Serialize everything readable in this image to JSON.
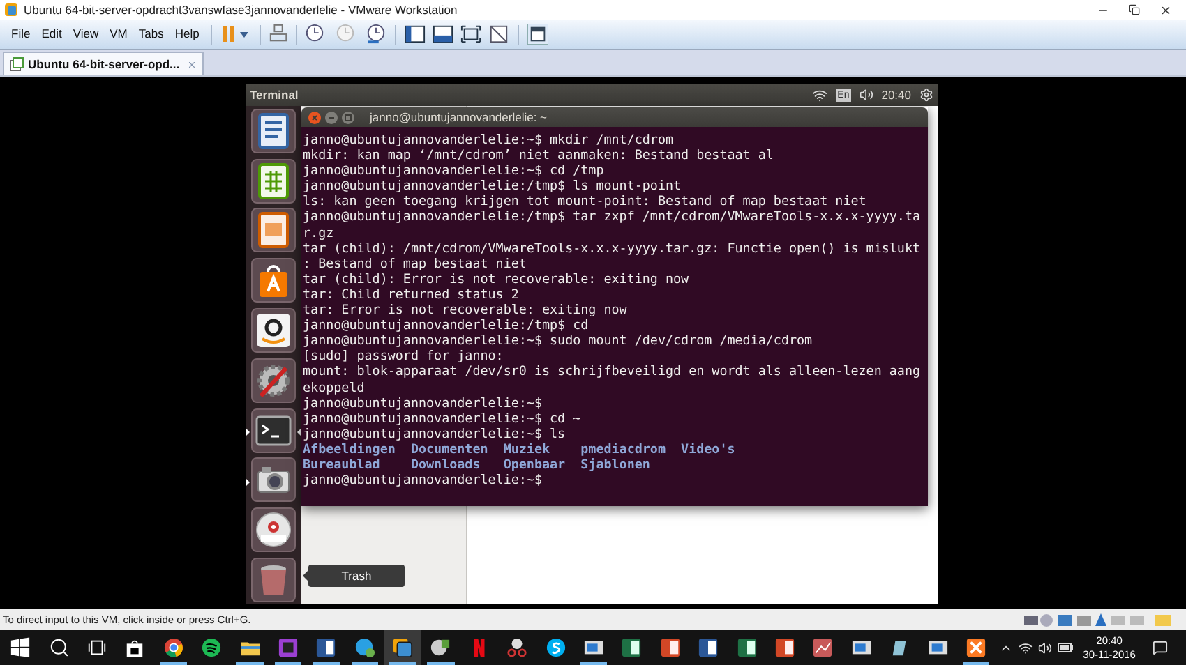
{
  "window": {
    "title": "Ubuntu 64-bit-server-opdracht3vanswfase3jannovanderlelie - VMware Workstation"
  },
  "menu": [
    "File",
    "Edit",
    "View",
    "VM",
    "Tabs",
    "Help"
  ],
  "tabs": [
    {
      "label": "Ubuntu 64-bit-server-opd...",
      "selected": true
    }
  ],
  "ubuntu_panel": {
    "app_title": "Terminal",
    "keyboard": "En",
    "time": "20:40"
  },
  "launcher": {
    "items": [
      {
        "kind": "document",
        "running": false,
        "focused": false
      },
      {
        "kind": "spreadsheet",
        "running": false,
        "focused": false
      },
      {
        "kind": "presentation",
        "running": false,
        "focused": false
      },
      {
        "kind": "software-center",
        "running": false,
        "focused": false
      },
      {
        "kind": "amazon",
        "running": false,
        "focused": false
      },
      {
        "kind": "settings",
        "running": false,
        "focused": false
      },
      {
        "kind": "terminal",
        "running": true,
        "focused": true
      },
      {
        "kind": "camera",
        "running": true,
        "focused": false
      },
      {
        "kind": "dvd",
        "running": false,
        "focused": false
      },
      {
        "kind": "trash",
        "running": false,
        "focused": false
      }
    ],
    "tooltip": "Trash"
  },
  "terminal": {
    "title": "janno@ubuntujannovanderlelie: ~",
    "lines": [
      {
        "kind": "text",
        "text": "janno@ubuntujannovanderlelie:~$ mkdir /mnt/cdrom"
      },
      {
        "kind": "text",
        "text": "mkdir: kan map ‘/mnt/cdrom’ niet aanmaken: Bestand bestaat al"
      },
      {
        "kind": "text",
        "text": "janno@ubuntujannovanderlelie:~$ cd /tmp"
      },
      {
        "kind": "text",
        "text": "janno@ubuntujannovanderlelie:/tmp$ ls mount-point"
      },
      {
        "kind": "text",
        "text": "ls: kan geen toegang krijgen tot mount-point: Bestand of map bestaat niet"
      },
      {
        "kind": "text",
        "text": "janno@ubuntujannovanderlelie:/tmp$ tar zxpf /mnt/cdrom/VMwareTools-x.x.x-yyyy.ta"
      },
      {
        "kind": "text",
        "text": "r.gz"
      },
      {
        "kind": "text",
        "text": "tar (child): /mnt/cdrom/VMwareTools-x.x.x-yyyy.tar.gz: Functie open() is mislukt"
      },
      {
        "kind": "text",
        "text": ": Bestand of map bestaat niet"
      },
      {
        "kind": "text",
        "text": "tar (child): Error is not recoverable: exiting now"
      },
      {
        "kind": "text",
        "text": "tar: Child returned status 2"
      },
      {
        "kind": "text",
        "text": "tar: Error is not recoverable: exiting now"
      },
      {
        "kind": "text",
        "text": "janno@ubuntujannovanderlelie:/tmp$ cd"
      },
      {
        "kind": "text",
        "text": "janno@ubuntujannovanderlelie:~$ sudo mount /dev/cdrom /media/cdrom"
      },
      {
        "kind": "text",
        "text": "[sudo] password for janno:"
      },
      {
        "kind": "text",
        "text": "mount: blok-apparaat /dev/sr0 is schrijfbeveiligd en wordt als alleen-lezen aang"
      },
      {
        "kind": "text",
        "text": "ekoppeld"
      },
      {
        "kind": "text",
        "text": "janno@ubuntujannovanderlelie:~$"
      },
      {
        "kind": "text",
        "text": "janno@ubuntujannovanderlelie:~$ cd ~"
      },
      {
        "kind": "text",
        "text": "janno@ubuntujannovanderlelie:~$ ls"
      },
      {
        "kind": "listing",
        "items": [
          "Afbeeldingen",
          "Documenten",
          "Muziek",
          "pmediacdrom",
          "Video's"
        ]
      },
      {
        "kind": "listing",
        "items": [
          "Bureaublad",
          "Downloads",
          "Openbaar",
          "Sjablonen"
        ]
      },
      {
        "kind": "text",
        "text": "janno@ubuntujannovanderlelie:~$"
      }
    ]
  },
  "status_bar": {
    "hint": "To direct input to this VM, click inside or press Ctrl+G."
  },
  "taskbar": {
    "apps": [
      {
        "kind": "start",
        "running": false,
        "active": false
      },
      {
        "kind": "search",
        "running": false,
        "active": false
      },
      {
        "kind": "task-view",
        "running": false,
        "active": false
      },
      {
        "kind": "store",
        "running": false,
        "active": false
      },
      {
        "kind": "browser",
        "running": true,
        "active": false
      },
      {
        "kind": "music",
        "running": false,
        "active": false
      },
      {
        "kind": "folder",
        "running": true,
        "active": false
      },
      {
        "kind": "ide",
        "running": true,
        "active": false
      },
      {
        "kind": "word",
        "running": true,
        "active": false
      },
      {
        "kind": "chat",
        "running": true,
        "active": false
      },
      {
        "kind": "vm",
        "running": true,
        "active": true
      },
      {
        "kind": "disc-app",
        "running": true,
        "active": false
      },
      {
        "kind": "video",
        "running": false,
        "active": false
      },
      {
        "kind": "scissors",
        "running": false,
        "active": false
      },
      {
        "kind": "phone",
        "running": false,
        "active": false
      },
      {
        "kind": "window",
        "running": true,
        "active": false
      },
      {
        "kind": "excel",
        "running": false,
        "active": false
      },
      {
        "kind": "powerpoint",
        "running": false,
        "active": false
      },
      {
        "kind": "word",
        "running": false,
        "active": false
      },
      {
        "kind": "excel",
        "running": false,
        "active": false
      },
      {
        "kind": "powerpoint",
        "running": false,
        "active": false
      },
      {
        "kind": "chart",
        "running": false,
        "active": false
      },
      {
        "kind": "window",
        "running": false,
        "active": false
      },
      {
        "kind": "pen",
        "running": false,
        "active": false
      },
      {
        "kind": "window",
        "running": false,
        "active": false
      },
      {
        "kind": "server",
        "running": true,
        "active": false
      }
    ],
    "time": "20:40",
    "date": "30-11-2016"
  }
}
